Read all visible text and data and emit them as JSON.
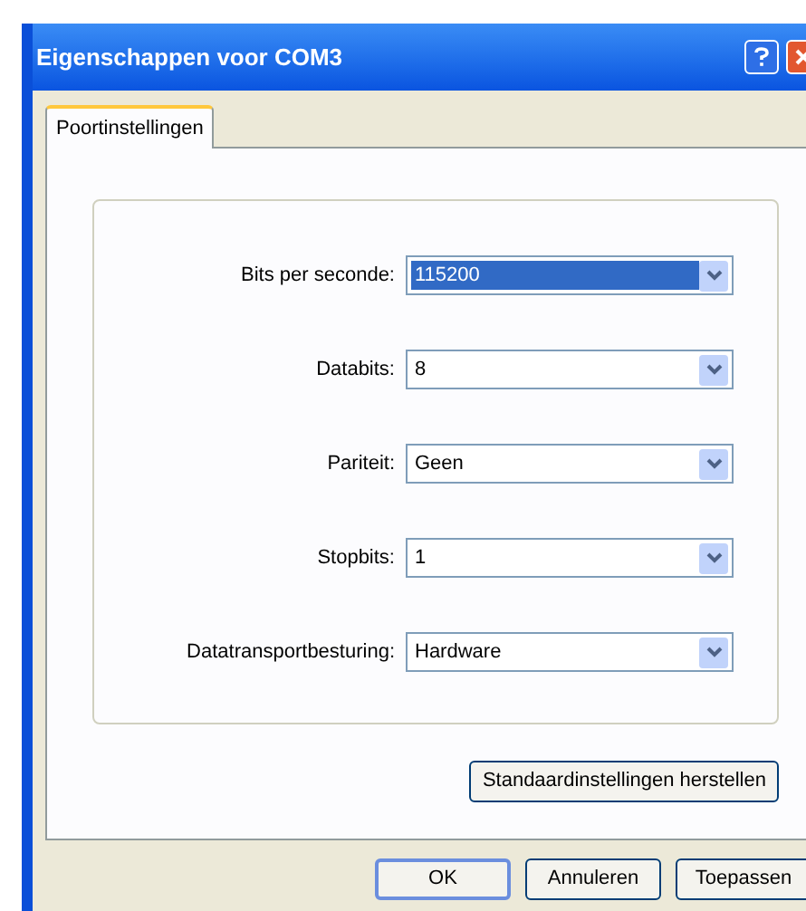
{
  "window": {
    "title": "Eigenschappen voor COM3"
  },
  "tabs": [
    {
      "label": "Poortinstellingen",
      "selected": true
    }
  ],
  "settings": [
    {
      "label": "Bits per seconde:",
      "value": "115200",
      "focused": true
    },
    {
      "label": "Databits:",
      "value": "8",
      "focused": false
    },
    {
      "label": "Pariteit:",
      "value": "Geen",
      "focused": false
    },
    {
      "label": "Stopbits:",
      "value": "1",
      "focused": false
    },
    {
      "label": "Datatransportbesturing:",
      "value": "Hardware",
      "focused": false
    }
  ],
  "restore_button": "Standaardinstellingen herstellen",
  "buttons": [
    {
      "label": "OK",
      "default": true
    },
    {
      "label": "Annuleren",
      "default": false
    },
    {
      "label": "Toepassen",
      "default": false
    }
  ]
}
